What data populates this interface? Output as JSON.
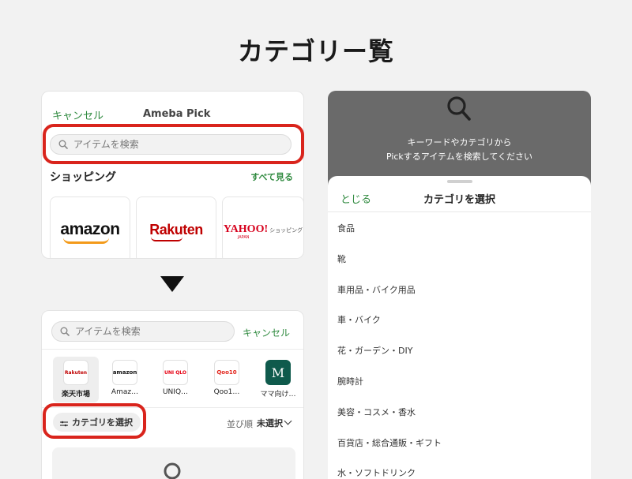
{
  "page_title": "カテゴリー覧",
  "panel_search": {
    "cancel": "キャンセル",
    "app_title": "Ameba Pick",
    "search_placeholder": "アイテムを検索",
    "shopping_heading": "ショッピング",
    "see_all": "すべて見る",
    "shops": [
      {
        "logo": "amazon"
      },
      {
        "logo": "Rakuten"
      },
      {
        "logo": "YAHOO!",
        "sub": "ショッピング",
        "tag": "JAPAN"
      }
    ]
  },
  "panel_results": {
    "search_placeholder": "アイテムを検索",
    "cancel": "キャンセル",
    "stores": [
      {
        "label": "楽天市場",
        "icon_text": "Rakuten",
        "icon_color": "#bf0000",
        "active": true
      },
      {
        "label": "Amaz…",
        "icon_text": "amazon",
        "icon_color": "#111111",
        "active": false
      },
      {
        "label": "UNIQ…",
        "icon_text": "UNI QLO",
        "icon_color": "#e60012",
        "active": false
      },
      {
        "label": "Qoo1…",
        "icon_text": "Qoo10",
        "icon_color": "#e2231a",
        "active": false
      },
      {
        "label": "ママ向け…",
        "icon_text": "M",
        "icon_color": "#0f5a4c",
        "active": false
      }
    ],
    "category_button": "カテゴリを選択",
    "sort_label": "並び順",
    "sort_value": "未選択"
  },
  "panel_category": {
    "empty_line1": "キーワードやカテゴリから",
    "empty_line2": "Pickするアイテムを検索してください",
    "close": "とじる",
    "title": "カテゴリを選択",
    "categories": [
      "食品",
      "靴",
      "車用品・バイク用品",
      "車・バイク",
      "花・ガーデン・DIY",
      "腕時計",
      "美容・コスメ・香水",
      "百貨店・総合通販・ギフト",
      "水・ソフトドリンク"
    ]
  },
  "colors": {
    "accent_green": "#2f8a3f",
    "highlight_red": "#d9241c",
    "overlay_gray": "#6a6a6a"
  }
}
